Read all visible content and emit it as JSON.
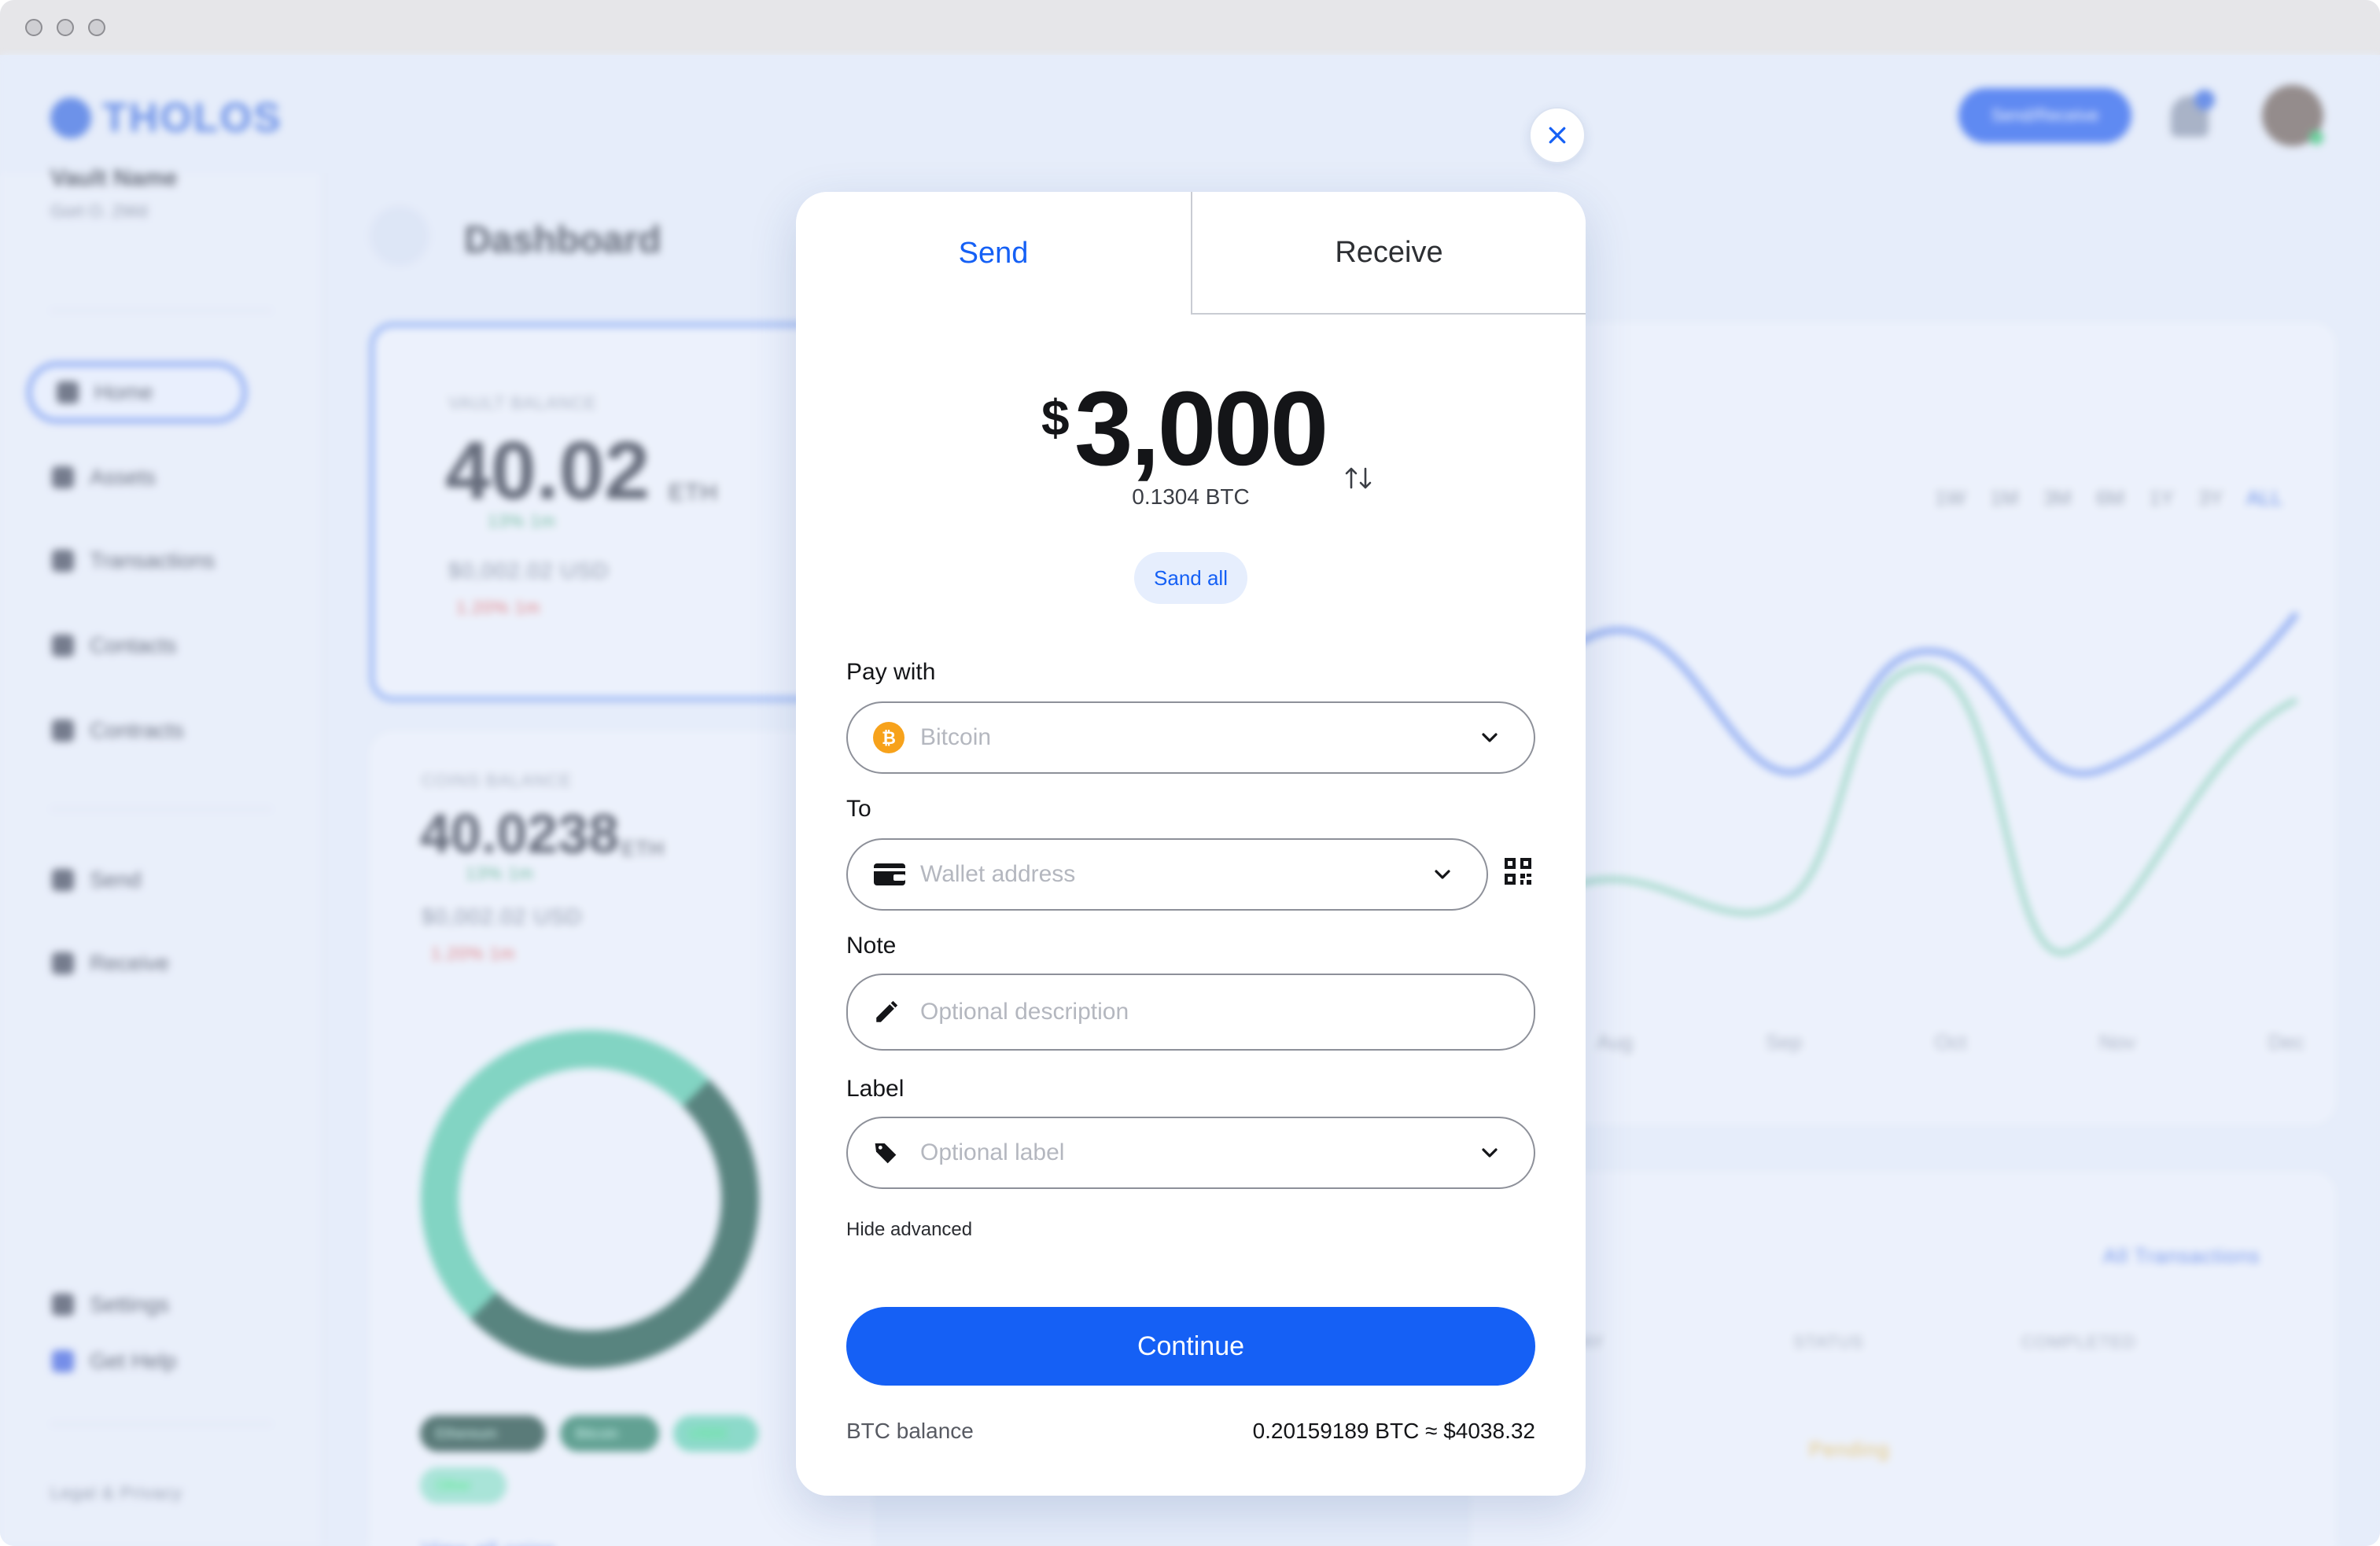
{
  "window": {
    "traffic_lights": [
      "close",
      "minimize",
      "zoom"
    ]
  },
  "background": {
    "brand": "THOLOS",
    "top_button": "Send/Receive",
    "vault": {
      "name": "Vault Name",
      "sub": "Gort O. 2Wd"
    },
    "nav": [
      {
        "label": "Home",
        "icon": "home-icon"
      },
      {
        "label": "Assets",
        "icon": "assets-icon"
      },
      {
        "label": "Transactions",
        "icon": "transactions-icon"
      },
      {
        "label": "Contacts",
        "icon": "contacts-icon"
      },
      {
        "label": "Contracts",
        "icon": "contracts-icon"
      }
    ],
    "nav_actions": [
      {
        "label": "Send",
        "icon": "send-icon"
      },
      {
        "label": "Receive",
        "icon": "receive-icon"
      }
    ],
    "nav_bottom": [
      {
        "label": "Settings",
        "icon": "settings-icon"
      },
      {
        "label": "Get Help",
        "icon": "help-icon"
      }
    ],
    "footer_link": "Legal & Privacy",
    "page_title": "Dashboard",
    "vault_balance": {
      "label": "VAULT BALANCE",
      "value": "40.02",
      "unit": "ETH",
      "change": "13% 1m",
      "usd": "$0,002.02 USD",
      "usd_change": "1.20% 1m"
    },
    "coins_balance": {
      "label": "COINS BALANCE",
      "value": "40.0238",
      "unit": "ETH",
      "change": "13% 1m",
      "usd": "$0,002.02 USD",
      "usd_change": "1.20% 1m"
    },
    "coin_chips": [
      "Ethereum",
      "Bitcoin",
      "USDC",
      "Other"
    ],
    "view_all_coins": "View all coins",
    "chart": {
      "ranges": [
        "1W",
        "1M",
        "3M",
        "6M",
        "1Y",
        "3Y",
        "ALL"
      ],
      "active_range": "ALL",
      "months": [
        "Aug",
        "Sep",
        "Oct",
        "Nov",
        "Dec"
      ]
    },
    "transactions": {
      "link": "All Transactions",
      "columns": [
        "AY",
        "STATUS",
        "COMPLETED"
      ],
      "status": "Pending"
    }
  },
  "modal": {
    "tabs": {
      "send": "Send",
      "receive": "Receive"
    },
    "active_tab": "Send",
    "amount": {
      "currency_symbol": "$",
      "value": "3,000",
      "btc_equivalent": "0.1304 BTC"
    },
    "send_all_label": "Sand all",
    "pay_with": {
      "label": "Pay with",
      "value": "Bitcoin",
      "icon": "bitcoin-icon"
    },
    "to": {
      "label": "To",
      "placeholder": "Wallet address",
      "icon": "wallet-icon",
      "qr_icon": "qr-code-icon"
    },
    "note": {
      "label": "Note",
      "placeholder": "Optional description",
      "icon": "pencil-icon"
    },
    "label_field": {
      "label": "Label",
      "placeholder": "Optional label",
      "icon": "tag-icon"
    },
    "hide_advanced": "Hide advanced",
    "continue_label": "Continue",
    "balance": {
      "label": "BTC balance",
      "value": "0.20159189 BTC ≈ $4038.32"
    }
  },
  "colors": {
    "accent": "#1560f5",
    "bitcoin": "#f7a21b",
    "modal_bg": "#ffffff"
  }
}
